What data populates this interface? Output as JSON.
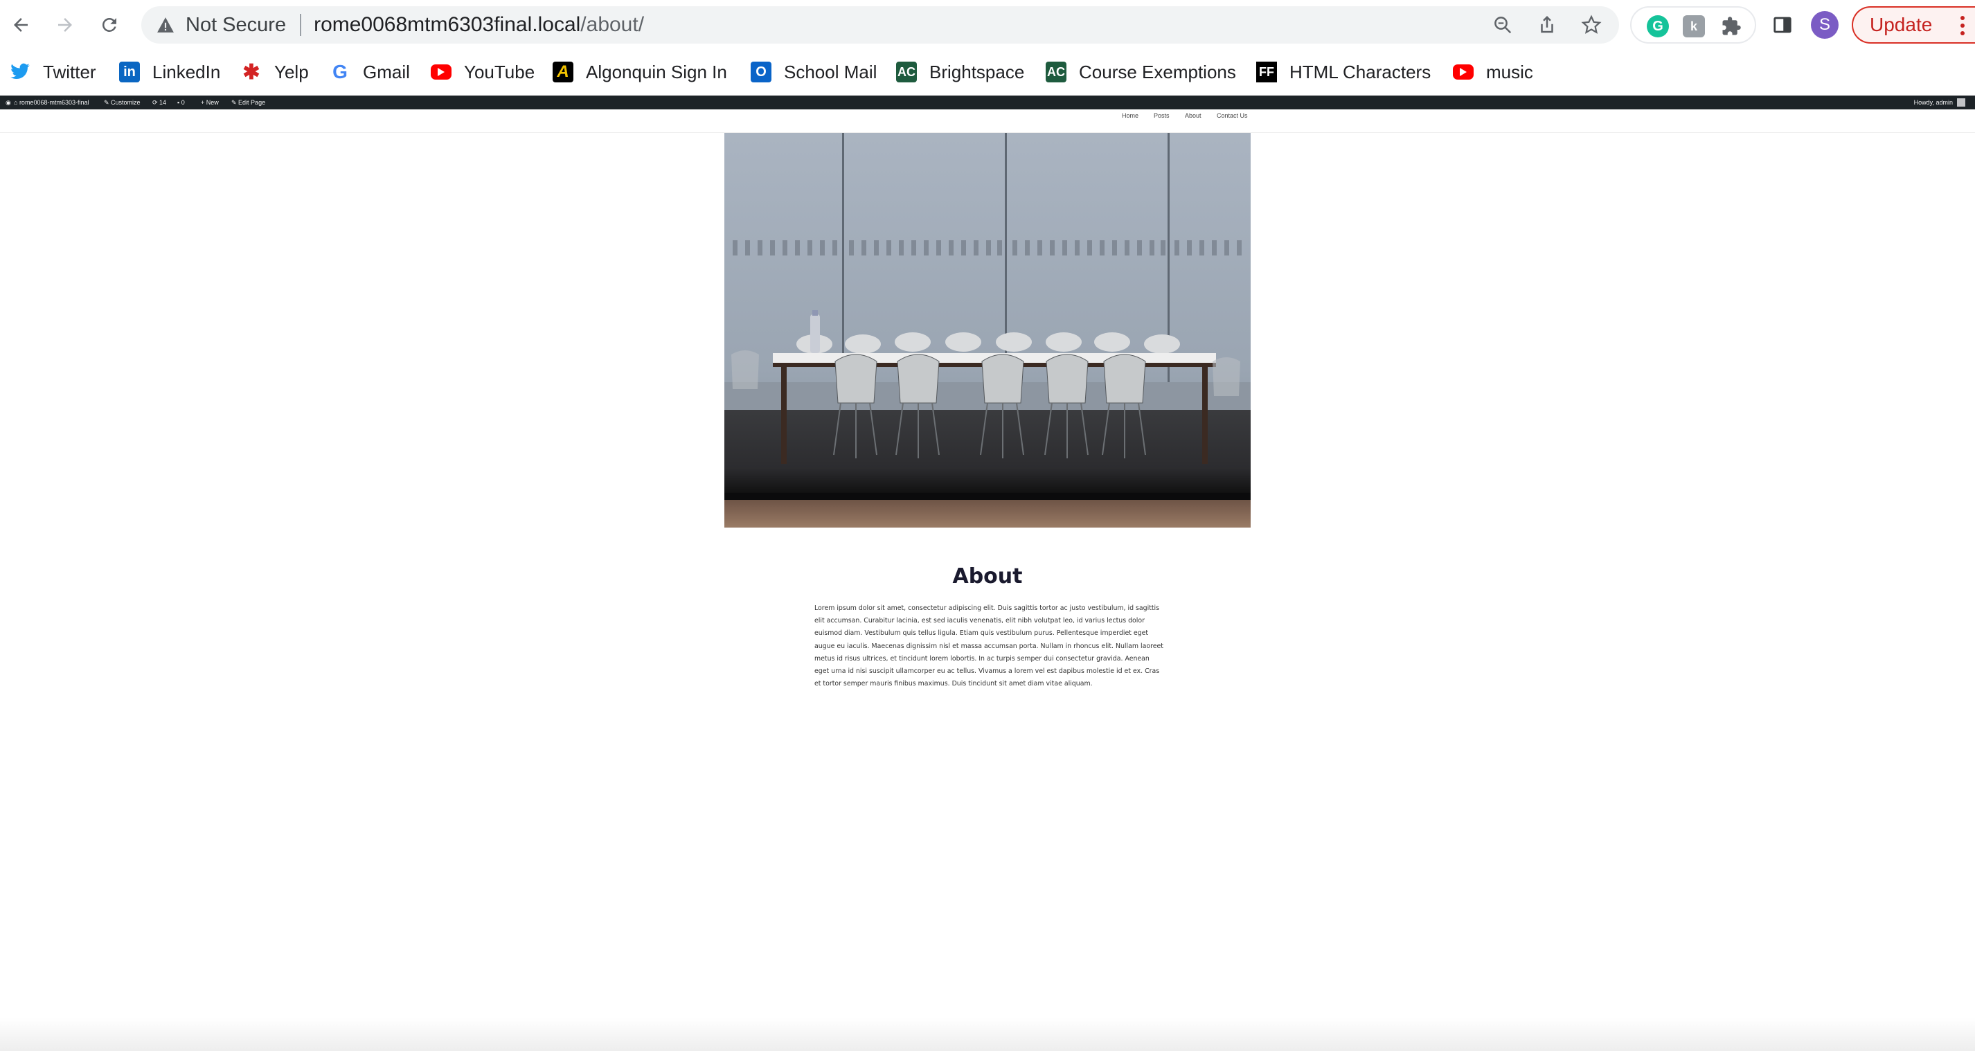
{
  "browser": {
    "security_label": "Not Secure",
    "url_host": "rome0068mtm6303final.local",
    "url_path": "/about/",
    "profile_initial": "S",
    "update_label": "Update",
    "colors": {
      "update_border": "#d93025",
      "avatar": "#7b5cc4",
      "omnibox": "#f1f3f4"
    }
  },
  "bookmarks": [
    {
      "label": "Twitter",
      "icon": "twitter-icon"
    },
    {
      "label": "LinkedIn",
      "icon": "linkedin-icon"
    },
    {
      "label": "Yelp",
      "icon": "yelp-icon"
    },
    {
      "label": "Gmail",
      "icon": "google-icon"
    },
    {
      "label": "YouTube",
      "icon": "youtube-icon"
    },
    {
      "label": "Algonquin Sign In",
      "icon": "algonquin-icon"
    },
    {
      "label": "School Mail",
      "icon": "outlook-icon"
    },
    {
      "label": "Brightspace",
      "icon": "brightspace-icon"
    },
    {
      "label": "Course Exemptions",
      "icon": "brightspace-icon"
    },
    {
      "label": "HTML Characters",
      "icon": "ff-icon"
    },
    {
      "label": "music",
      "icon": "youtube-icon"
    }
  ],
  "admin_bar": {
    "site_name": "rome0068-mtm6303-final",
    "customize": "Customize",
    "updates_count": "14",
    "comments_count": "0",
    "new_label": "New",
    "edit_label": "Edit Page",
    "greeting": "Howdy, admin"
  },
  "site_nav": [
    "Home",
    "Posts",
    "About",
    "Contact Us"
  ],
  "page": {
    "title": "About",
    "hero_image": "conference-room-photo",
    "body": "Lorem ipsum dolor sit amet, consectetur adipiscing elit. Duis sagittis tortor ac justo vestibulum, id sagittis elit accumsan. Curabitur lacinia, est sed iaculis venenatis, elit nibh volutpat leo, id varius lectus dolor euismod diam. Vestibulum quis tellus ligula. Etiam quis vestibulum purus. Pellentesque imperdiet eget augue eu iaculis. Maecenas dignissim nisl et massa accumsan porta. Nullam in rhoncus elit. Nullam laoreet metus id risus ultrices, et tincidunt lorem lobortis. In ac turpis semper dui consectetur gravida. Aenean eget urna id nisi suscipit ullamcorper eu ac tellus. Vivamus a lorem vel est dapibus molestie id et ex. Cras et tortor semper mauris finibus maximus. Duis tincidunt sit amet diam vitae aliquam."
  }
}
